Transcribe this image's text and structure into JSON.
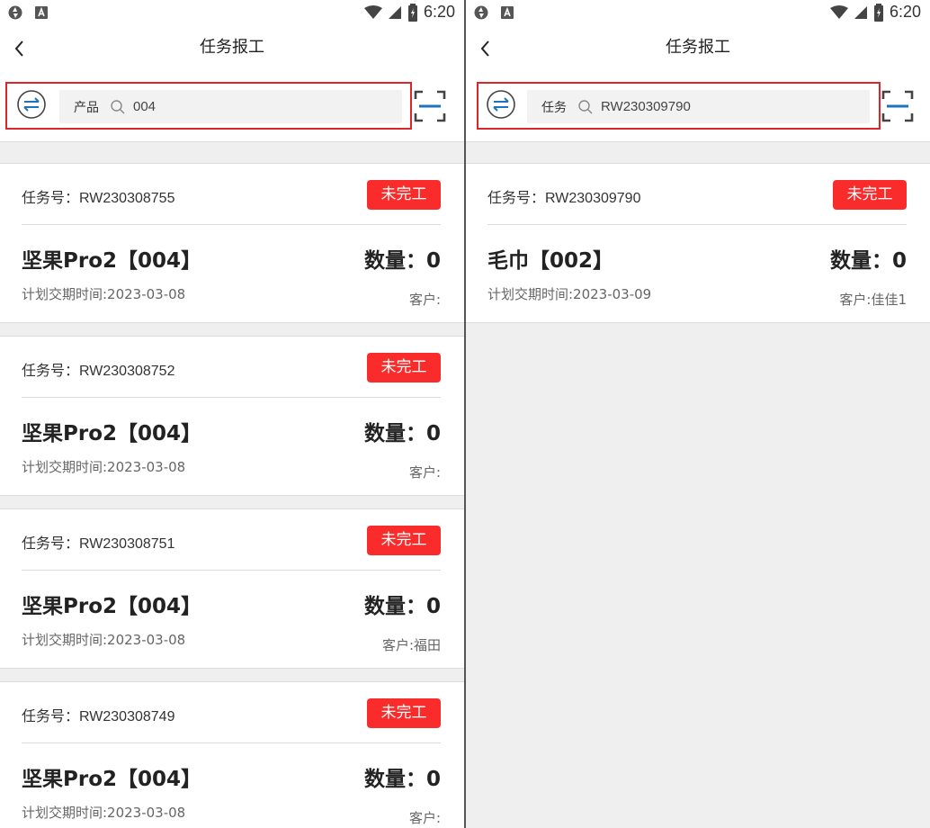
{
  "status_bar": {
    "time": "6:20"
  },
  "page_title": "任务报工",
  "left_screen": {
    "search": {
      "mode_label": "产品",
      "value": "004"
    },
    "cards": [
      {
        "task_label": "任务号：",
        "task_no": "RW230308755",
        "status": "未完工",
        "product": "坚果Pro2【004】",
        "qty": "数量：0",
        "plan_date": "计划交期时间:2023-03-08",
        "customer": "客户:"
      },
      {
        "task_label": "任务号：",
        "task_no": "RW230308752",
        "status": "未完工",
        "product": "坚果Pro2【004】",
        "qty": "数量：0",
        "plan_date": "计划交期时间:2023-03-08",
        "customer": "客户:"
      },
      {
        "task_label": "任务号：",
        "task_no": "RW230308751",
        "status": "未完工",
        "product": "坚果Pro2【004】",
        "qty": "数量：0",
        "plan_date": "计划交期时间:2023-03-08",
        "customer": "客户:福田"
      },
      {
        "task_label": "任务号：",
        "task_no": "RW230308749",
        "status": "未完工",
        "product": "坚果Pro2【004】",
        "qty": "数量：0",
        "plan_date": "计划交期时间:2023-03-08",
        "customer": "客户:"
      }
    ]
  },
  "right_screen": {
    "search": {
      "mode_label": "任务",
      "value": "RW230309790"
    },
    "cards": [
      {
        "task_label": "任务号：",
        "task_no": "RW230309790",
        "status": "未完工",
        "product": "毛巾【002】",
        "qty": "数量：0",
        "plan_date": "计划交期时间:2023-03-09",
        "customer": "客户:佳佳1"
      }
    ]
  },
  "colors": {
    "status_red": "#fa2b2b",
    "highlight_red": "#d9262b",
    "icon_blue": "#1e73be"
  },
  "icons": [
    "settings-status-icon",
    "sim-a-icon",
    "wifi-icon",
    "signal-icon",
    "battery-icon",
    "back-arrow-icon",
    "switch-search-mode-icon",
    "search-icon",
    "scan-icon"
  ]
}
